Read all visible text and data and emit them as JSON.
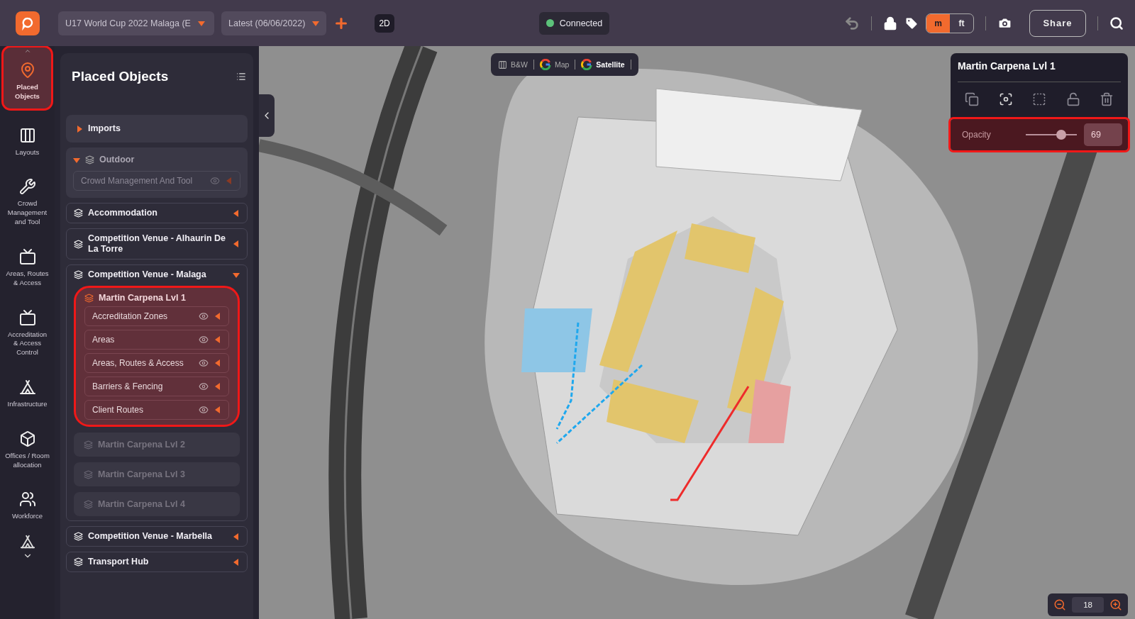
{
  "topbar": {
    "event_select": "U17 World Cup 2022 Malaga (E",
    "version_select": "Latest (06/06/2022)",
    "view_mode": "2D",
    "status": {
      "label": "Connected",
      "connected": true
    },
    "units": [
      {
        "label": "m",
        "selected": true
      },
      {
        "label": "ft",
        "selected": false
      }
    ],
    "share": "Share"
  },
  "rail": [
    {
      "label": "Placed Objects",
      "selected": true,
      "annotated": true
    },
    {
      "label": "Layouts",
      "selected": false,
      "annotated": false
    },
    {
      "label": "Crowd Management and Tool",
      "selected": false,
      "annotated": false
    },
    {
      "label": "Areas, Routes & Access",
      "selected": false,
      "annotated": false
    },
    {
      "label": "Accreditation & Access Control",
      "selected": false,
      "annotated": false
    },
    {
      "label": "Infrastructure",
      "selected": false,
      "annotated": false
    },
    {
      "label": "Offices / Room allocation",
      "selected": false,
      "annotated": false
    },
    {
      "label": "Workforce",
      "selected": false,
      "annotated": false
    }
  ],
  "panel": {
    "title": "Placed Objects",
    "tree": [
      {
        "kind": "folder",
        "label": "Imports",
        "expanded": false
      },
      {
        "kind": "group",
        "label": "Outdoor",
        "expanded": true,
        "children": [
          {
            "kind": "layer",
            "label": "Crowd Management And Tool",
            "dimmed": true
          }
        ]
      },
      {
        "kind": "group",
        "label": "Accommodation",
        "expanded": false
      },
      {
        "kind": "group",
        "label": "Competition Venue - Alhaurin De La Torre",
        "expanded": false
      },
      {
        "kind": "group",
        "label": "Competition Venue - Malaga",
        "expanded": true,
        "children": [
          {
            "kind": "level",
            "label": "Martin Carpena Lvl 1",
            "active": true,
            "annotated": true,
            "children": [
              {
                "kind": "layer",
                "label": "Accreditation Zones",
                "dimmed": false
              },
              {
                "kind": "layer",
                "label": "Areas",
                "dimmed": false
              },
              {
                "kind": "layer",
                "label": "Areas, Routes & Access",
                "dimmed": false
              },
              {
                "kind": "layer",
                "label": "Barriers & Fencing",
                "dimmed": false
              },
              {
                "kind": "layer",
                "label": "Client Routes",
                "dimmed": false
              }
            ]
          },
          {
            "kind": "level",
            "label": "Martin Carpena Lvl 2",
            "active": false,
            "annotated": false
          },
          {
            "kind": "level",
            "label": "Martin Carpena Lvl 3",
            "active": false,
            "annotated": false
          },
          {
            "kind": "level",
            "label": "Martin Carpena Lvl 4",
            "active": false,
            "annotated": false
          }
        ]
      },
      {
        "kind": "group",
        "label": "Competition Venue - Marbella",
        "expanded": false
      },
      {
        "kind": "group",
        "label": "Transport Hub",
        "expanded": false
      }
    ]
  },
  "map_types": [
    {
      "label": "B&W",
      "kind": "bw",
      "selected": false
    },
    {
      "label": "Map",
      "kind": "google",
      "selected": false
    },
    {
      "label": "Satellite",
      "kind": "google",
      "selected": true
    }
  ],
  "inspector": {
    "title": "Martin Carpena Lvl 1",
    "opacity": {
      "label": "Opacity",
      "level": 0.69,
      "value": "69",
      "annotated": true
    }
  },
  "zoom": {
    "value": "18"
  }
}
